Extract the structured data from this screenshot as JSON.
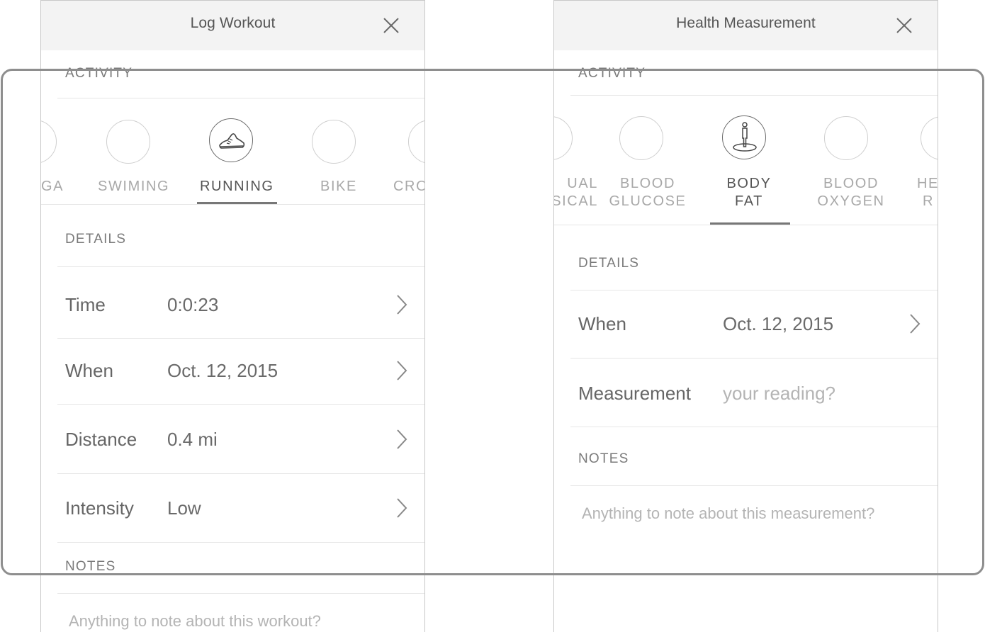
{
  "left": {
    "title": "Log Workout",
    "activity_label": "ACTIVITY",
    "activities": [
      {
        "label": "GA",
        "icon": "none"
      },
      {
        "label": "SWIMING",
        "icon": "none"
      },
      {
        "label": "RUNNING",
        "icon": "shoe-icon",
        "selected": true
      },
      {
        "label": "BIKE",
        "icon": "none"
      },
      {
        "label": "CRO",
        "icon": "none"
      }
    ],
    "details_label": "DETAILS",
    "rows": [
      {
        "label": "Time",
        "value": "0:0:23"
      },
      {
        "label": "When",
        "value": "Oct. 12, 2015"
      },
      {
        "label": "Distance",
        "value": "0.4 mi"
      },
      {
        "label": "Intensity",
        "value": "Low"
      }
    ],
    "notes_label": "NOTES",
    "notes_placeholder": "Anything to note about this workout?"
  },
  "right": {
    "title": "Health Measurement",
    "activity_label": "ACTIVITY",
    "activities": [
      {
        "line1": "UAL",
        "line2": "SICAL",
        "icon": "none"
      },
      {
        "line1": "BLOOD",
        "line2": "GLUCOSE",
        "icon": "none"
      },
      {
        "line1": "BODY",
        "line2": "FAT",
        "icon": "body-fat-icon",
        "selected": true
      },
      {
        "line1": "BLOOD",
        "line2": "OXYGEN",
        "icon": "none"
      },
      {
        "line1": "HE",
        "line2": "R",
        "icon": "none"
      }
    ],
    "details_label": "DETAILS",
    "when_label": "When",
    "when_value": "Oct. 12, 2015",
    "measurement_label": "Measurement",
    "measurement_placeholder": "your reading?",
    "notes_label": "NOTES",
    "notes_placeholder": "Anything to note about this measurement?"
  },
  "colors": {
    "header_bg": "#f3f3f3",
    "selected_accent": "#777777",
    "overlay_frame": "#8e8e8e"
  }
}
